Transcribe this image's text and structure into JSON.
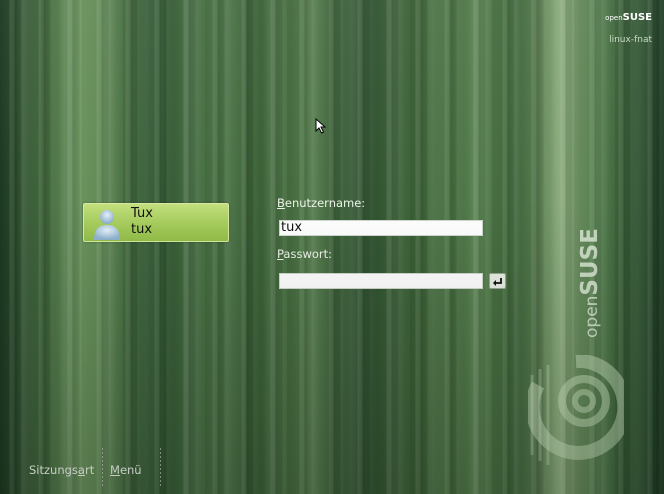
{
  "branding": {
    "top_right_thin": "open",
    "top_right_bold": "SUSE",
    "hostname": "linux-fnat",
    "vertical_thin": "open",
    "vertical_bold": "SUSE"
  },
  "user": {
    "display_name": "Tux",
    "login": "tux"
  },
  "form": {
    "username_label_accel": "B",
    "username_label_rest": "enutzername:",
    "username_value": "tux",
    "password_label_accel": "P",
    "password_label_rest": "asswort:",
    "password_value": ""
  },
  "bottom": {
    "session_pre": "Sitzungs",
    "session_accel": "a",
    "session_post": "rt",
    "menu_accel": "M",
    "menu_rest": "enü"
  },
  "colors": {
    "accent_green": "#a6cd5c",
    "background_green": "#3b5f38"
  },
  "icons": [
    "user-avatar-icon",
    "enter-arrow-icon",
    "mouse-cursor-icon",
    "opensuse-gecko-logo"
  ]
}
